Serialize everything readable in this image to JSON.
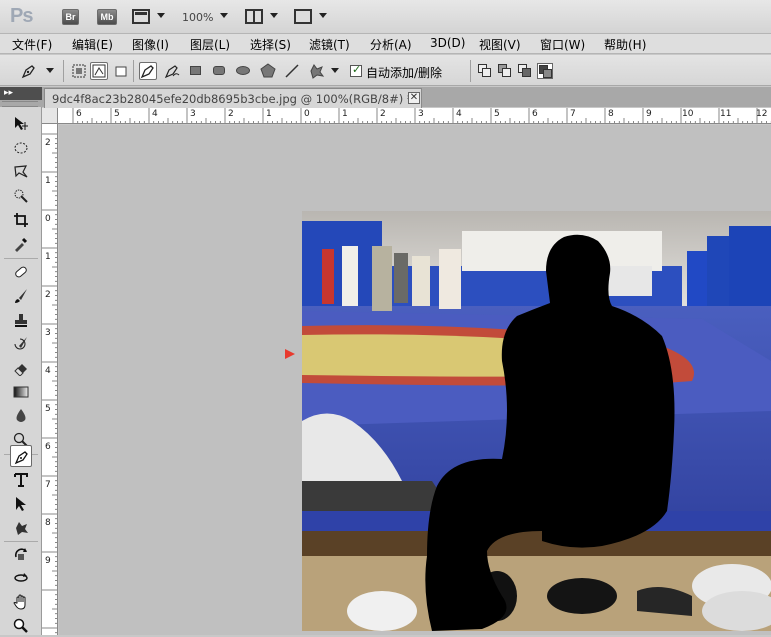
{
  "app": {
    "logo": "Ps",
    "bridge_label": "Br",
    "minibridge_label": "Mb",
    "zoom": "100%"
  },
  "menu": [
    {
      "id": "file",
      "label": "文件(F)"
    },
    {
      "id": "edit",
      "label": "编辑(E)"
    },
    {
      "id": "image",
      "label": "图像(I)"
    },
    {
      "id": "layer",
      "label": "图层(L)"
    },
    {
      "id": "select",
      "label": "选择(S)"
    },
    {
      "id": "filter",
      "label": "滤镜(T)"
    },
    {
      "id": "analysis",
      "label": "分析(A)"
    },
    {
      "id": "3d",
      "label": "3D(D)"
    },
    {
      "id": "view",
      "label": "视图(V)"
    },
    {
      "id": "window",
      "label": "窗口(W)"
    },
    {
      "id": "help",
      "label": "帮助(H)"
    }
  ],
  "options": {
    "auto_add_delete_label": "自动添加/删除",
    "auto_add_delete_checked": true
  },
  "panel_collapse_label": "▸▸",
  "document": {
    "tab_title": "9dc4f8ac23b28045efe20db8695b3cbe.jpg @ 100%(RGB/8#) *",
    "close_label": "✕"
  },
  "rulers": {
    "horizontal": [
      "6",
      "5",
      "4",
      "3",
      "2",
      "1",
      "0",
      "1",
      "2",
      "3",
      "4",
      "5",
      "6",
      "7",
      "8",
      "9",
      "10",
      "11",
      "12"
    ],
    "vertical": [
      "2",
      "1",
      "0",
      "1",
      "2",
      "3",
      "4",
      "5",
      "6",
      "7",
      "8",
      "9"
    ]
  },
  "colors": {
    "accent_guide": "#e83a2e",
    "mat_blue": "#3146a8",
    "mat_yellow": "#d9c873",
    "mat_red": "#c24b3a",
    "silhouette": "#000000",
    "wall_blue": "#1f47b8"
  }
}
